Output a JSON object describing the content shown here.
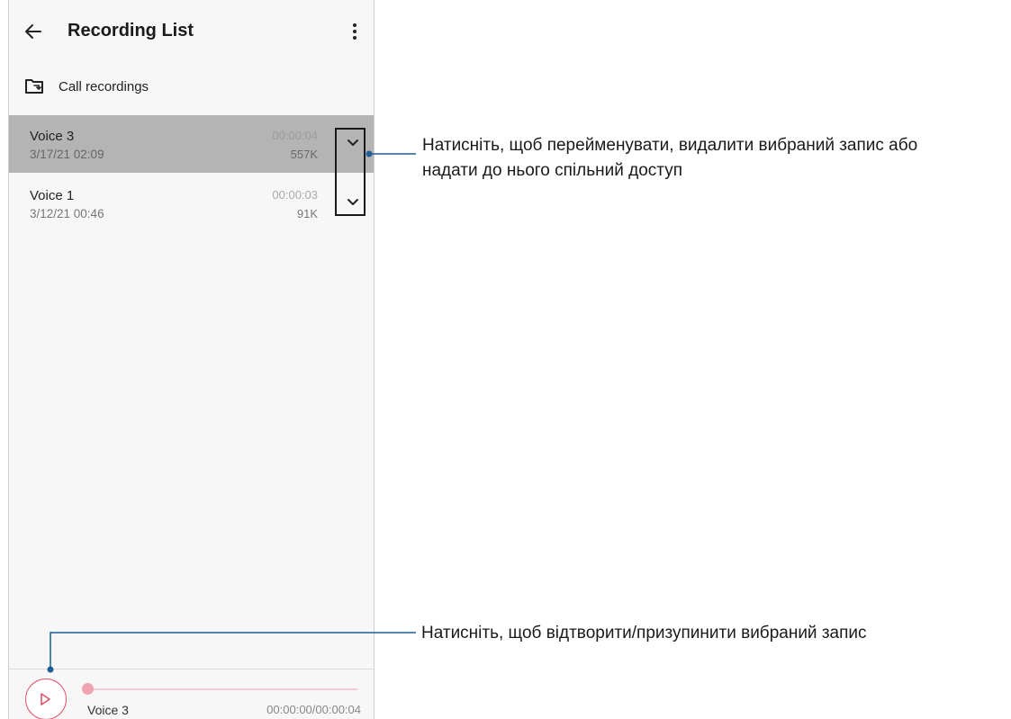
{
  "app_bar": {
    "title": "Recording List",
    "back_icon": "arrow-left-icon",
    "menu_icon": "more-vert-icon"
  },
  "folder": {
    "label": "Call recordings",
    "icon": "folder-sync-icon"
  },
  "recordings": [
    {
      "name": "Voice 3",
      "date": "3/17/21 02:09",
      "duration": "00:00:04",
      "size": "557K",
      "selected": true
    },
    {
      "name": "Voice 1",
      "date": "3/12/21 00:46",
      "duration": "00:00:03",
      "size": "91K",
      "selected": false
    }
  ],
  "player": {
    "name": "Voice 3",
    "time": "00:00:00/00:00:04",
    "progress": 0,
    "play_icon": "play-icon"
  },
  "callouts": {
    "expand_line1": "Натисніть, щоб перейменувати, видалити вибраний запис або",
    "expand_line2": "надати до нього спільний доступ",
    "play": "Натисніть, щоб відтворити/призупинити вибраний запис"
  },
  "colors": {
    "accent": "#e2526b",
    "selected_row": "#b4b4b4",
    "callout_line": "#1f5f96"
  }
}
